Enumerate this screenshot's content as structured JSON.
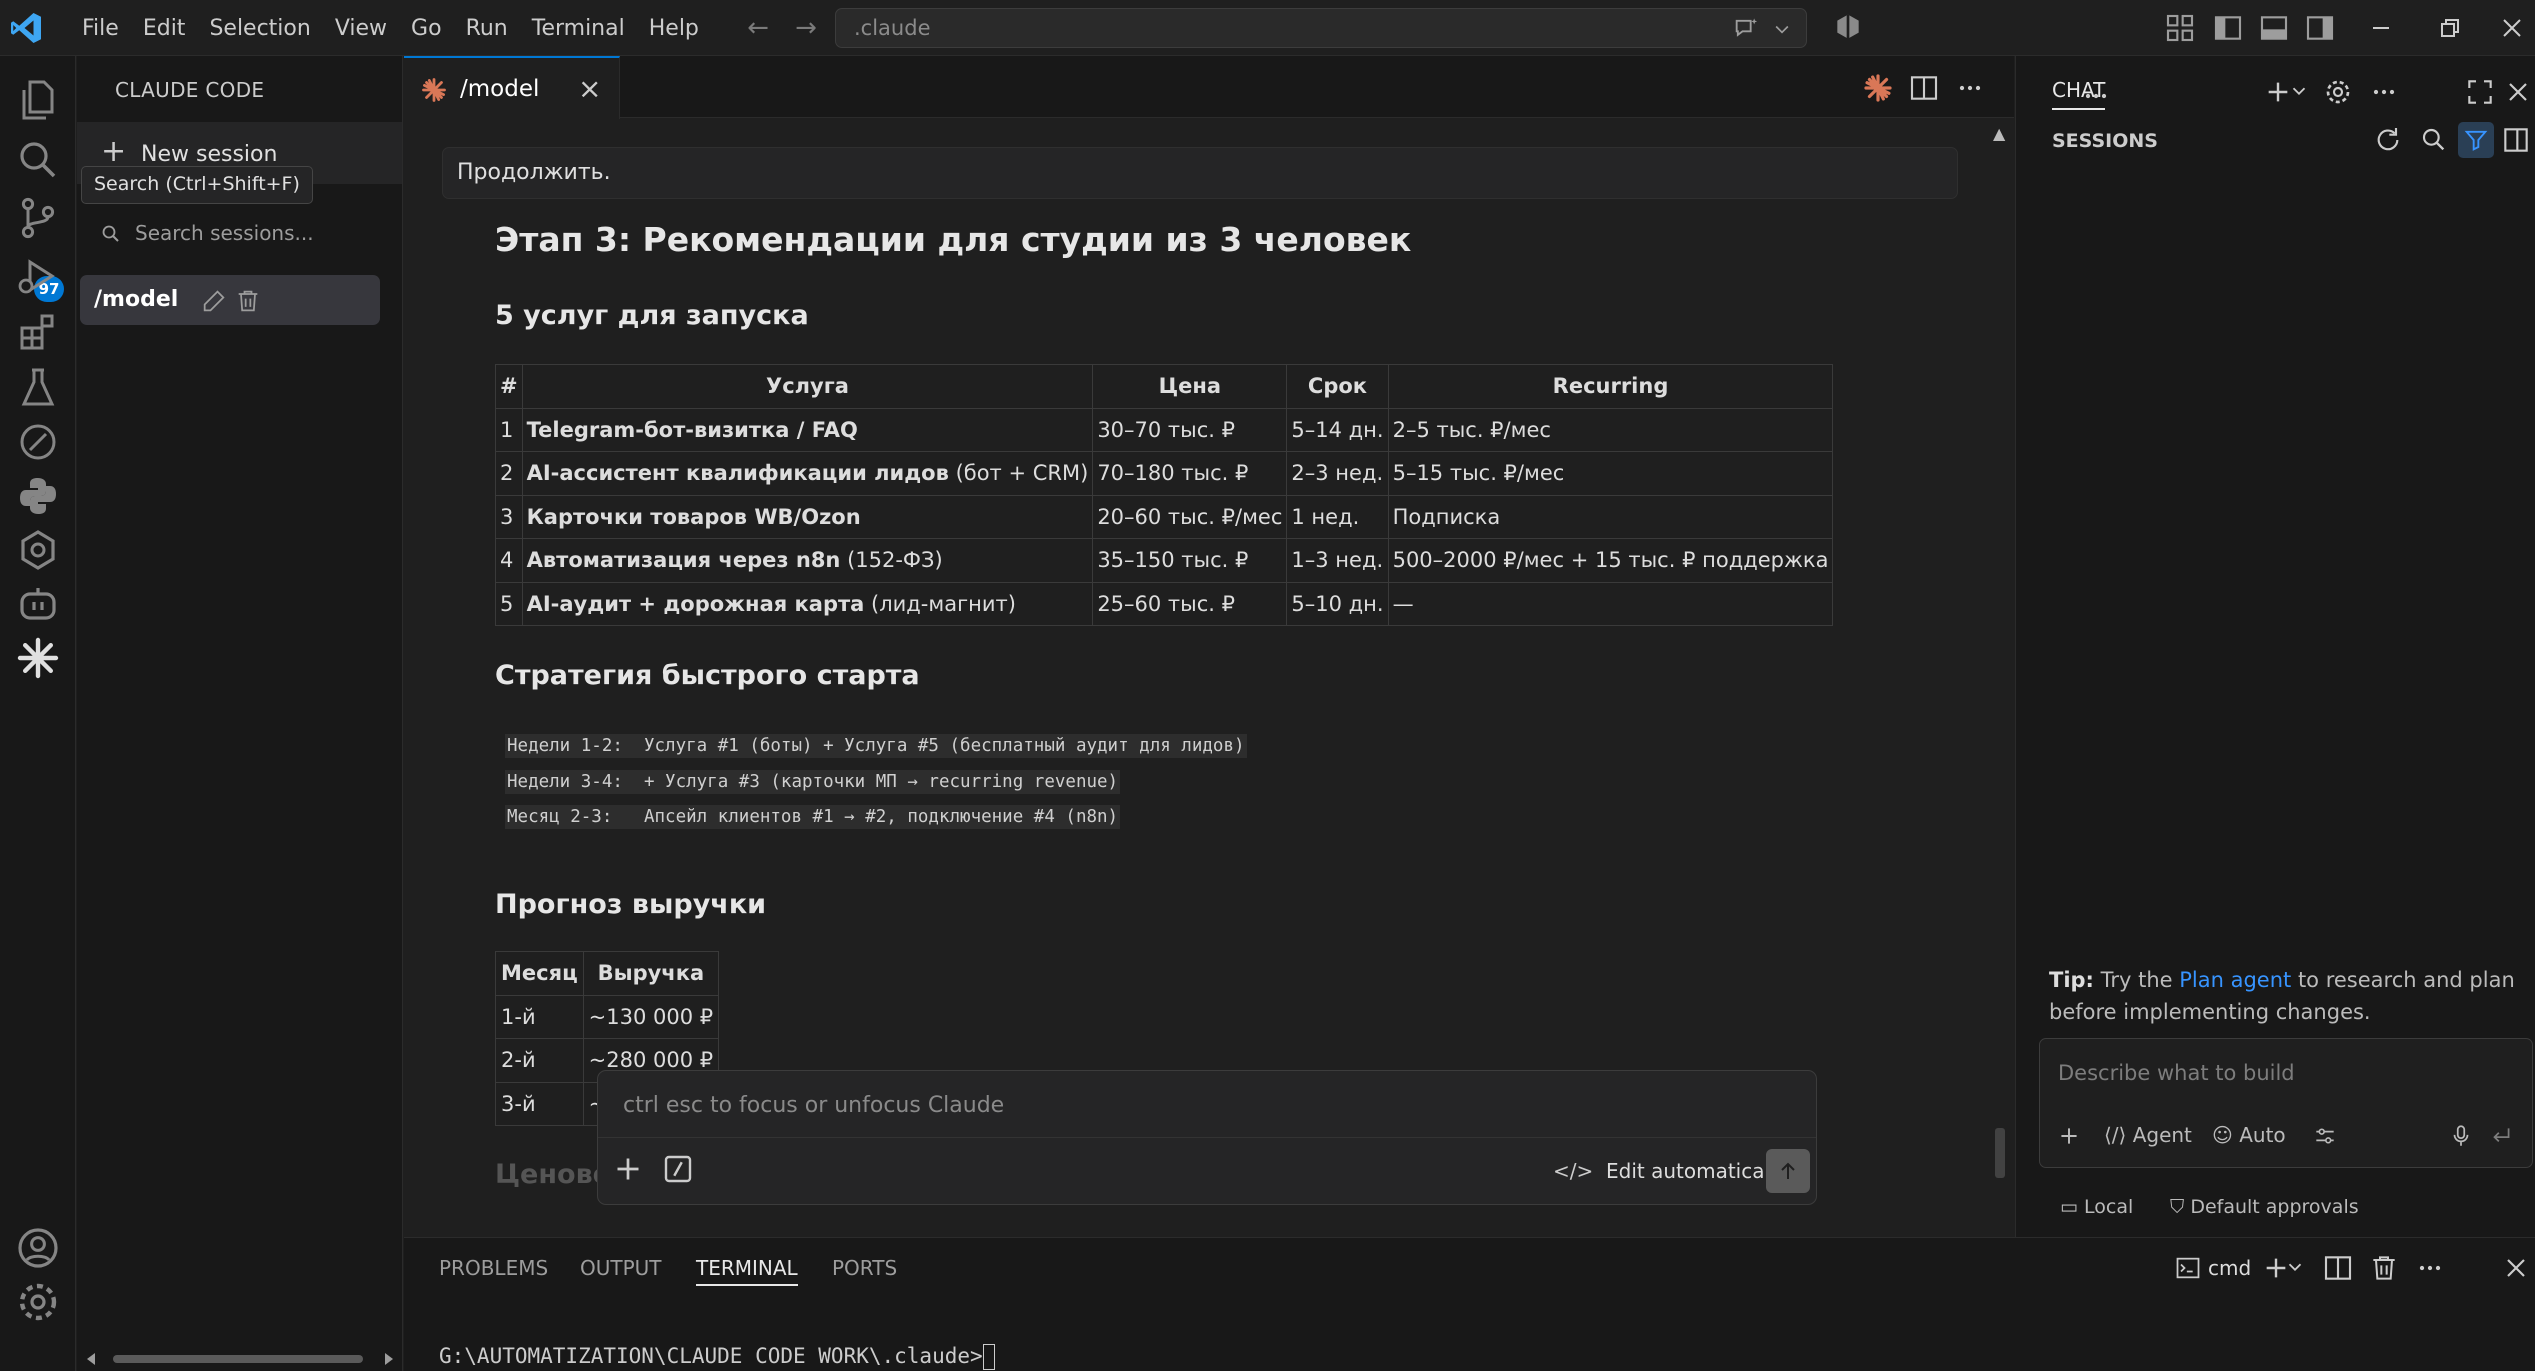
{
  "titlebar": {
    "menu": [
      "File",
      "Edit",
      "Selection",
      "View",
      "Go",
      "Run",
      "Terminal",
      "Help"
    ],
    "search_text": ".claude"
  },
  "activity": {
    "scm_badge": "97"
  },
  "sidebar": {
    "title": "CLAUDE CODE",
    "new_session": "New session",
    "tooltip": "Search (Ctrl+Shift+F)",
    "search_placeholder": "Search sessions...",
    "session_name": "/model"
  },
  "editor": {
    "tab_label": "/model",
    "prev_message": "Продолжить.",
    "h_stage": "Этап 3: Рекомендации для студии из 3 человек",
    "h_services": "5 услуг для запуска",
    "services_table": {
      "headers": [
        "#",
        "Услуга",
        "Цена",
        "Срок",
        "Recurring"
      ],
      "rows": [
        {
          "n": "1",
          "bold": "Telegram-бот-визитка / FAQ",
          "rest": "",
          "price": "30–70 тыс. ₽",
          "term": "5–14 дн.",
          "recurring": "2–5 тыс. ₽/мес"
        },
        {
          "n": "2",
          "bold": "AI-ассистент квалификации лидов",
          "rest": " (бот + CRM)",
          "price": "70–180 тыс. ₽",
          "term": "2–3 нед.",
          "recurring": "5–15 тыс. ₽/мес"
        },
        {
          "n": "3",
          "bold": "Карточки товаров WB/Ozon",
          "rest": "",
          "price": "20–60 тыс. ₽/мес",
          "term": "1 нед.",
          "recurring": "Подписка"
        },
        {
          "n": "4",
          "bold": "Автоматизация через n8n",
          "rest": " (152-ФЗ)",
          "price": "35–150 тыс. ₽",
          "term": "1–3 нед.",
          "recurring": "500–2000 ₽/мес + 15 тыс. ₽ поддержка"
        },
        {
          "n": "5",
          "bold": "AI-аудит + дорожная карта",
          "rest": " (лид-магнит)",
          "price": "25–60 тыс. ₽",
          "term": "5–10 дн.",
          "recurring": "—"
        }
      ]
    },
    "h_strategy": "Стратегия быстрого старта",
    "code_lines": [
      "Недели 1-2:  Услуга #1 (боты) + Услуга #5 (бесплатный аудит для лидов)",
      "Недели 3-4:  + Услуга #3 (карточки МП → recurring revenue)",
      "Месяц 2-3:   Апсейл клиентов #1 → #2, подключение #4 (n8n)"
    ],
    "h_forecast": "Прогноз выручки",
    "revenue_table": {
      "headers": [
        "Месяц",
        "Выручка"
      ],
      "rows": [
        [
          "1-й",
          "~130 000 ₽"
        ],
        [
          "2-й",
          "~280 000 ₽"
        ],
        [
          "3-й",
          "~"
        ]
      ]
    },
    "h_faded": "Ценово",
    "input_placeholder": "ctrl esc to focus or unfocus Claude",
    "edit_mode": "Edit automatically"
  },
  "panel": {
    "tabs": [
      "PROBLEMS",
      "OUTPUT",
      "TERMINAL",
      "PORTS"
    ],
    "active_tab": "TERMINAL",
    "shell": "cmd",
    "prompt": "G:\\AUTOMATIZATION\\CLAUDE CODE WORK\\.claude>"
  },
  "chat": {
    "title": "CHAT",
    "sessions_label": "SESSIONS",
    "tip_bold": "Tip:",
    "tip_pre": " Try the ",
    "tip_link": "Plan agent",
    "tip_post": " to research and plan before implementing changes.",
    "input_placeholder": "Describe what to build",
    "agent_label": "Agent",
    "auto_label": "Auto",
    "local_label": "Local",
    "approvals_label": "Default approvals"
  },
  "colors": {
    "accent": "#0078d4",
    "claude_orange": "#d97757",
    "link": "#3794ff"
  }
}
